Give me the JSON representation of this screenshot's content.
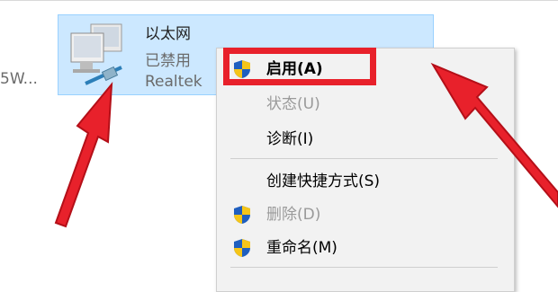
{
  "background_items": {
    "left_item_truncated": "5W..."
  },
  "adapter": {
    "name": "以太网",
    "status": "已禁用",
    "driver": "Realtek"
  },
  "context_menu": {
    "items": [
      {
        "label": "启用(A)",
        "state": "enabled",
        "bold": true,
        "icon": "uac-shield-icon"
      },
      {
        "label": "状态(U)",
        "state": "disabled"
      },
      {
        "label": "诊断(I)",
        "state": "enabled"
      },
      {
        "label": "创建快捷方式(S)",
        "state": "enabled"
      },
      {
        "label": "删除(D)",
        "state": "disabled",
        "icon": "uac-shield-icon"
      },
      {
        "label": "重命名(M)",
        "state": "enabled",
        "icon": "uac-shield-icon"
      }
    ]
  },
  "annotations": {
    "highlight_color": "#e8212b",
    "arrow_color": "#e8212b"
  },
  "colors": {
    "selection_bg": "#cce8ff",
    "selection_border": "#99d1ff",
    "menu_bg": "#f2f2f2"
  }
}
